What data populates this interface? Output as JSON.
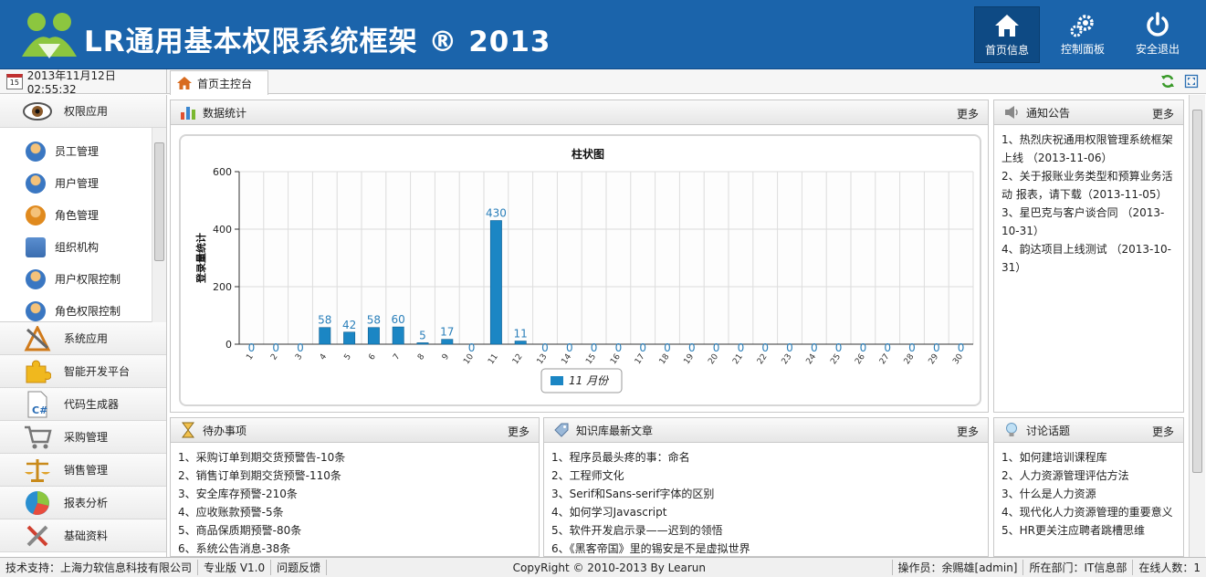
{
  "app": {
    "title": "LR通用基本权限系统框架 ® 2013"
  },
  "header_buttons": [
    {
      "label": "首页信息",
      "icon": "home-icon"
    },
    {
      "label": "控制面板",
      "icon": "gear-icon"
    },
    {
      "label": "安全退出",
      "icon": "power-icon"
    }
  ],
  "datetime": "2013年11月12日 02:55:32",
  "tabs": [
    {
      "label": "首页主控台"
    }
  ],
  "sidebar": {
    "top": {
      "label": "权限应用",
      "icon": "eye-icon"
    },
    "sub_items": [
      {
        "label": "员工管理"
      },
      {
        "label": "用户管理"
      },
      {
        "label": "角色管理"
      },
      {
        "label": "组织机构"
      },
      {
        "label": "用户权限控制"
      },
      {
        "label": "角色权限控制"
      }
    ],
    "groups": [
      {
        "label": "系统应用",
        "icon": "tools-icon"
      },
      {
        "label": "智能开发平台",
        "icon": "puzzle-icon"
      },
      {
        "label": "代码生成器",
        "icon": "csharp-file-icon"
      },
      {
        "label": "采购管理",
        "icon": "cart-icon"
      },
      {
        "label": "销售管理",
        "icon": "scales-icon"
      },
      {
        "label": "报表分析",
        "icon": "pie-chart-icon"
      },
      {
        "label": "基础资料",
        "icon": "wrench-icon"
      }
    ]
  },
  "stats_panel": {
    "title": "数据统计",
    "more": "更多"
  },
  "notice_panel": {
    "title": "通知公告",
    "more": "更多",
    "items": [
      "1、热烈庆祝通用权限管理系统框架上线 （2013-11-06）",
      "2、关于报账业务类型和预算业务活动 报表，请下载（2013-11-05）",
      "3、星巴克与客户谈合同 （2013-10-31）",
      "4、韵达项目上线测试 （2013-10-31）"
    ]
  },
  "todo_panel": {
    "title": "待办事项",
    "more": "更多",
    "items": [
      "1、采购订单到期交货预警告-10条",
      "2、销售订单到期交货预警-110条",
      "3、安全库存预警-210条",
      "4、应收账款预警-5条",
      "5、商品保质期预警-80条",
      "6、系统公告消息-38条"
    ]
  },
  "kb_panel": {
    "title": "知识库最新文章",
    "more": "更多",
    "items": [
      "1、程序员最头疼的事：命名",
      "2、工程师文化",
      "3、Serif和Sans-serif字体的区别",
      "4、如何学习Javascript",
      "5、软件开发启示录——迟到的领悟",
      "6、《黑客帝国》里的锡安是不是虚拟世界"
    ]
  },
  "topic_panel": {
    "title": "讨论话题",
    "more": "更多",
    "items": [
      "1、如何建培训课程库",
      "2、人力资源管理评估方法",
      "3、什么是人力资源",
      "4、现代化人力资源管理的重要意义",
      "5、HR更关注应聘者跳槽思维"
    ]
  },
  "chart_data": {
    "type": "bar",
    "title": "柱状图",
    "ylabel": "登录量统计",
    "xlabel": "",
    "ylim": [
      0,
      600
    ],
    "yticks": [
      "0",
      "200",
      "400",
      "600"
    ],
    "categories": [
      "1",
      "2",
      "3",
      "4",
      "5",
      "6",
      "7",
      "8",
      "9",
      "10",
      "11",
      "12",
      "13",
      "14",
      "15",
      "16",
      "17",
      "18",
      "19",
      "20",
      "21",
      "22",
      "23",
      "24",
      "25",
      "26",
      "27",
      "28",
      "29",
      "30"
    ],
    "series": [
      {
        "name": "11 月份",
        "values": [
          0,
          0,
          0,
          58,
          42,
          58,
          60,
          5,
          17,
          0,
          430,
          11,
          0,
          0,
          0,
          0,
          0,
          0,
          0,
          0,
          0,
          0,
          0,
          0,
          0,
          0,
          0,
          0,
          0,
          0
        ]
      }
    ],
    "grid": true,
    "legend": "bottom-center",
    "bar_color": "#1b86c4"
  },
  "footer": {
    "support": "技术支持：上海力软信息科技有限公司",
    "edition": "专业版 V1.0",
    "feedback": "问题反馈",
    "copyright": "CopyRight © 2010-2013 By Learun",
    "operator": "操作员：余赐雄[admin]",
    "dept": "所在部门：IT信息部",
    "online": "在线人数：1"
  }
}
